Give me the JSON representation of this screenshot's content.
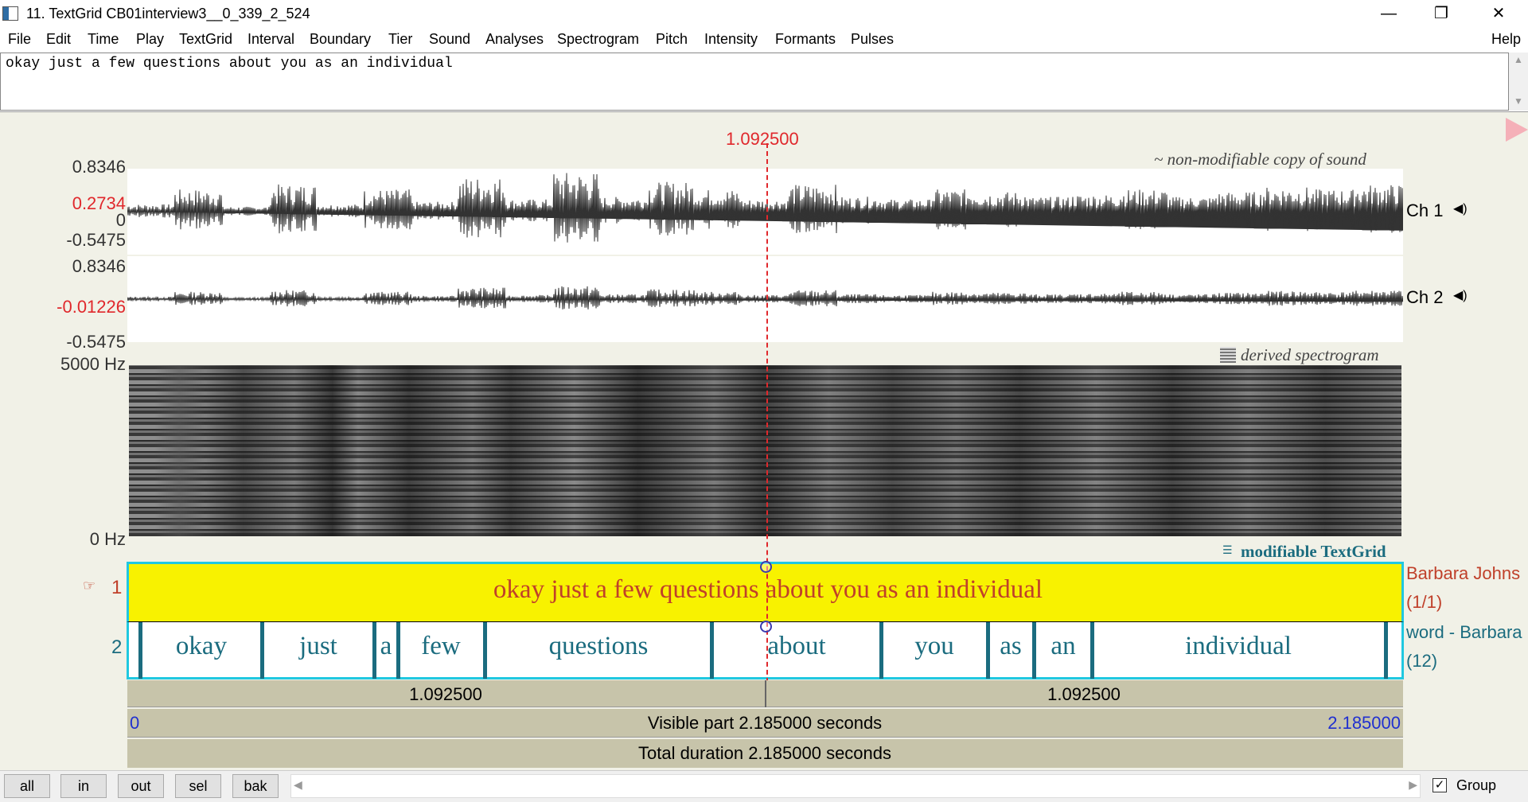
{
  "window": {
    "title": "11. TextGrid CB01interview3__0_339_2_524",
    "minimize_glyph": "—",
    "restore_glyph": "❐",
    "close_glyph": "✕"
  },
  "menu": [
    "File",
    "Edit",
    "Time",
    "Play",
    "TextGrid",
    "Interval",
    "Boundary",
    "Tier",
    "Sound",
    "Analyses",
    "Spectrogram",
    "Pitch",
    "Intensity",
    "Formants",
    "Pulses"
  ],
  "help": "Help",
  "text_field": "okay just a few questions about you as an individual",
  "cursor_time": "1.092500",
  "sound": {
    "label": "~ non-modifiable copy of sound",
    "ch1": {
      "label": "Ch 1",
      "max": "0.8346",
      "cursor_value": "0.2734",
      "zero": "0",
      "min": "-0.5475"
    },
    "ch2": {
      "label": "Ch 2",
      "max": "0.8346",
      "cursor_value": "-0.01226",
      "min": "-0.5475"
    }
  },
  "spectrogram": {
    "label": "derived spectrogram",
    "top": "5000 Hz",
    "bottom": "0 Hz"
  },
  "textgrid": {
    "label": "modifiable TextGrid",
    "tier1": {
      "number": "1",
      "text": "okay just a few questions about you as an individual",
      "name": "Barbara Johns",
      "count": "(1/1)"
    },
    "tier2": {
      "number": "2",
      "name": "word - Barbara",
      "count": "(12)",
      "words": [
        "okay",
        "just",
        "a",
        "few",
        "questions",
        "about",
        "you",
        "as",
        "an",
        "individual"
      ]
    }
  },
  "selection": {
    "left": "1.092500",
    "right": "1.092500"
  },
  "visible": {
    "start": "0",
    "label": "Visible part 2.185000 seconds",
    "end": "2.185000"
  },
  "total": "Total duration 2.185000 seconds",
  "buttons": [
    "all",
    "in",
    "out",
    "sel",
    "bak"
  ],
  "group": {
    "label": "Group",
    "checked": true
  },
  "colors": {
    "tier1_bg": "#f8f200",
    "tier_text": "#c0402a",
    "tier2_text": "#1b6c7f",
    "cursor": "#e0282c",
    "tier_border": "#20c8e0"
  }
}
